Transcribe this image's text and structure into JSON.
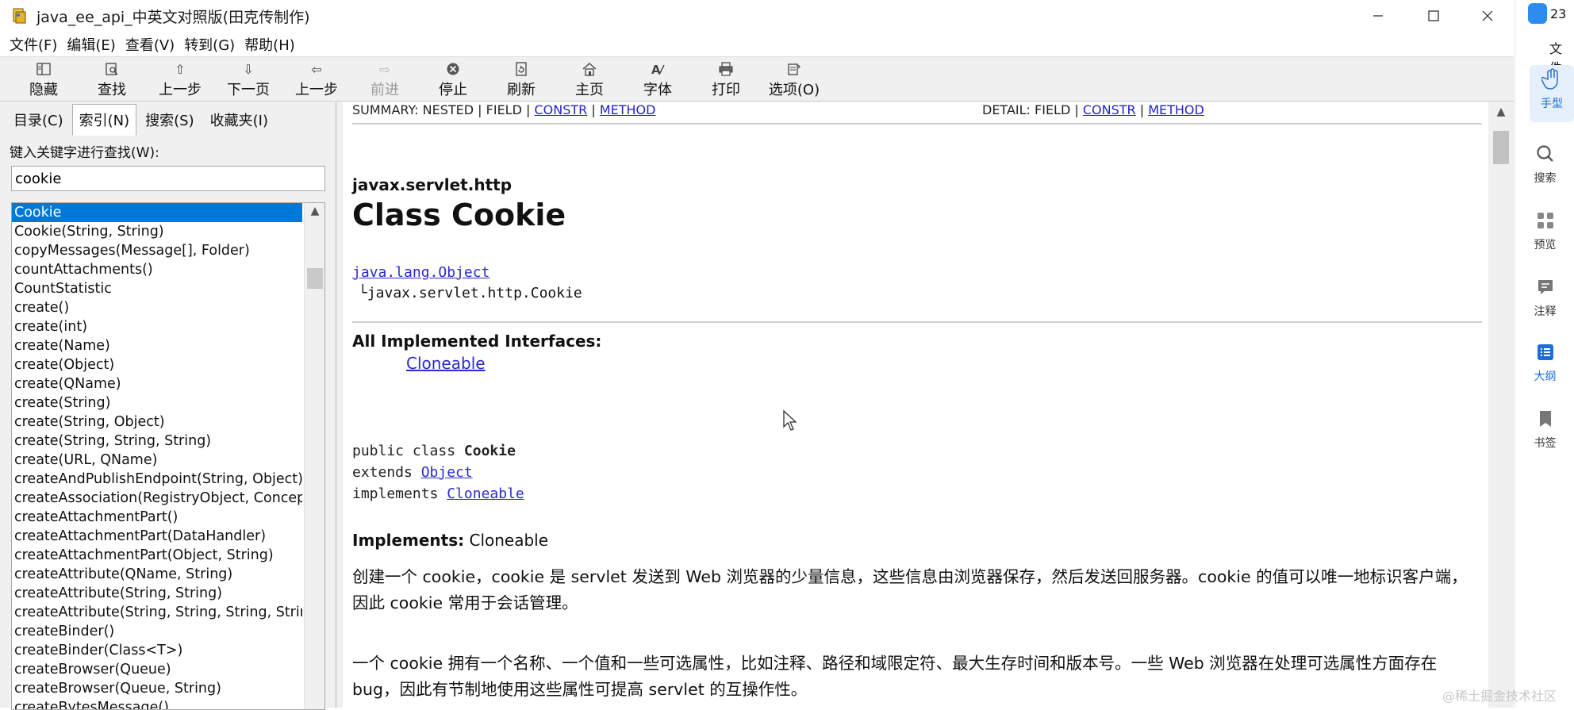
{
  "window": {
    "title": "java_ee_api_中英文对照版(田克传制作)"
  },
  "menu": [
    "文件(F)",
    "编辑(E)",
    "查看(V)",
    "转到(G)",
    "帮助(H)"
  ],
  "toolbar": [
    {
      "label": "隐藏",
      "icon": "hide-icon",
      "enabled": true
    },
    {
      "label": "查找",
      "icon": "find-icon",
      "enabled": true
    },
    {
      "label": "上一步",
      "icon": "up-arrow-icon",
      "enabled": true
    },
    {
      "label": "下一页",
      "icon": "down-arrow-icon",
      "enabled": true
    },
    {
      "label": "上一步",
      "icon": "left-arrow-icon",
      "enabled": true
    },
    {
      "label": "前进",
      "icon": "right-arrow-icon",
      "enabled": false
    },
    {
      "label": "停止",
      "icon": "stop-icon",
      "enabled": true
    },
    {
      "label": "刷新",
      "icon": "refresh-icon",
      "enabled": true
    },
    {
      "label": "主页",
      "icon": "home-icon",
      "enabled": true
    },
    {
      "label": "字体",
      "icon": "font-icon",
      "enabled": true
    },
    {
      "label": "打印",
      "icon": "print-icon",
      "enabled": true
    },
    {
      "label": "选项(O)",
      "icon": "options-icon",
      "enabled": true
    }
  ],
  "nav": {
    "tabs": [
      "目录(C)",
      "索引(N)",
      "搜索(S)",
      "收藏夹(I)"
    ],
    "active_tab": 1,
    "keyword_label": "键入关键字进行查找(W):",
    "keyword_value": "cookie",
    "list": [
      "Cookie",
      "Cookie(String, String)",
      "copyMessages(Message[], Folder)",
      "countAttachments()",
      "CountStatistic",
      "create()",
      "create(int)",
      "create(Name)",
      "create(Object)",
      "create(QName)",
      "create(String)",
      "create(String, Object)",
      "create(String, String, String)",
      "create(URL, QName)",
      "createAndPublishEndpoint(String, Object)",
      "createAssociation(RegistryObject, Concept)",
      "createAttachmentPart()",
      "createAttachmentPart(DataHandler)",
      "createAttachmentPart(Object, String)",
      "createAttribute(QName, String)",
      "createAttribute(String, String)",
      "createAttribute(String, String, String, String)",
      "createBinder()",
      "createBinder(Class<T>)",
      "createBrowser(Queue)",
      "createBrowser(Queue, String)",
      "createBytesMessage()"
    ],
    "selected_index": 0
  },
  "doc": {
    "summary_prefix": "SUMMARY: NESTED | FIELD | ",
    "summary_links": [
      "CONSTR",
      "METHOD"
    ],
    "detail_prefix": "DETAIL: FIELD | ",
    "detail_links": [
      "CONSTR",
      "METHOD"
    ],
    "package": "javax.servlet.http",
    "class_title": "Class Cookie",
    "hier_parent": "java.lang.Object",
    "hier_child": "└javax.servlet.http.Cookie",
    "implemented_heading": "All Implemented Interfaces:",
    "implemented_link": "Cloneable",
    "decl_line1_prefix": "public class ",
    "decl_line1_name": "Cookie",
    "decl_line2_prefix": "extends ",
    "decl_line2_link": "Object",
    "decl_line3_prefix": "implements ",
    "decl_line3_link": "Cloneable",
    "implements_label": "Implements:",
    "implements_value": " Cloneable",
    "para1": "创建一个 cookie，cookie 是 servlet 发送到 Web 浏览器的少量信息，这些信息由浏览器保存，然后发送回服务器。cookie 的值可以唯一地标识客户端，因此 cookie 常用于会话管理。",
    "para2": "一个 cookie 拥有一个名称、一个值和一些可选属性，比如注释、路径和域限定符、最大生存时间和版本号。一些 Web 浏览器在处理可选属性方面存在 bug，因此有节制地使用这些属性可提高 servlet 的互操作性。"
  },
  "sidepanel": {
    "top_number": "23",
    "file_label": "文件",
    "items": [
      {
        "label": "手型",
        "icon": "hand-icon",
        "active": true
      },
      {
        "label": "搜索",
        "icon": "search-icon",
        "active": false
      },
      {
        "label": "预览",
        "icon": "grid-icon",
        "active": false
      },
      {
        "label": "注释",
        "icon": "comment-icon",
        "active": false
      },
      {
        "label": "大纲",
        "icon": "outline-icon",
        "active": true
      },
      {
        "label": "书签",
        "icon": "bookmark-icon",
        "active": false
      }
    ]
  },
  "watermark": "@稀土掘金技术社区",
  "colors": {
    "selection": "#0078d7",
    "link": "#2a2ad0",
    "accent": "#1a6fd8"
  }
}
